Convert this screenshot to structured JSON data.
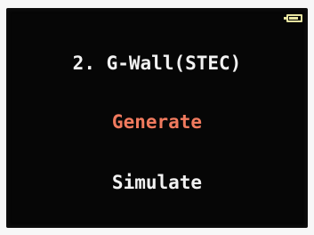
{
  "device": {
    "battery_icon": "battery-icon",
    "title": "2. G-Wall(STEC)",
    "menu": [
      {
        "label": "Generate",
        "selected": true,
        "color": "#f07a5e"
      },
      {
        "label": "Simulate",
        "selected": false,
        "color": "#f2f2f2"
      }
    ],
    "colors": {
      "screen_bg": "#060606",
      "text": "#f2f2f2",
      "highlight": "#f07a5e",
      "battery": "#e6e3a0"
    }
  }
}
